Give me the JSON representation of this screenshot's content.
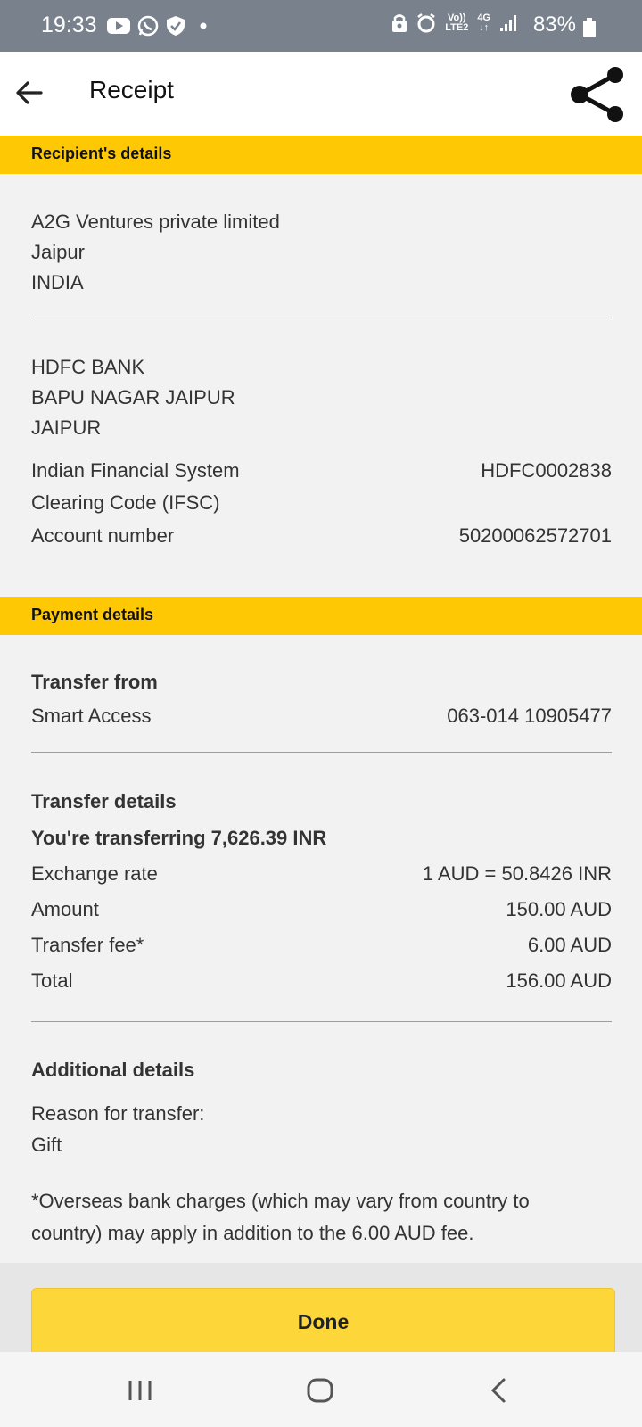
{
  "status_bar": {
    "time": "19:33",
    "battery": "83%",
    "network_top": "Vo))",
    "network_bottom": "LTE2",
    "net_type": "4G"
  },
  "header": {
    "title": "Receipt"
  },
  "recipient": {
    "section_title": "Recipient's details",
    "name": "A2G Ventures private limited",
    "city": "Jaipur",
    "country": "INDIA",
    "bank_name": "HDFC BANK",
    "branch": "BAPU NAGAR JAIPUR",
    "bank_city": "JAIPUR",
    "ifsc_label_1": "Indian Financial System",
    "ifsc_label_2": "Clearing Code (IFSC)",
    "ifsc_value": "HDFC0002838",
    "account_label": "Account number",
    "account_value": "50200062572701"
  },
  "payment": {
    "section_title": "Payment details",
    "transfer_from_heading": "Transfer from",
    "from_account_name": "Smart Access",
    "from_account_number": "063-014 10905477",
    "transfer_details_heading": "Transfer details",
    "transferring_text": "You're transferring 7,626.39 INR",
    "rows": [
      {
        "label": "Exchange rate",
        "value": "1 AUD = 50.8426 INR"
      },
      {
        "label": "Amount",
        "value": "150.00 AUD"
      },
      {
        "label": "Transfer fee*",
        "value": "6.00 AUD"
      },
      {
        "label": "Total",
        "value": "156.00 AUD"
      }
    ],
    "additional_heading": "Additional details",
    "reason_label": "Reason for transfer:",
    "reason_value": "Gift",
    "footnote_line1": "*Overseas bank charges (which may vary from country to",
    "footnote_line2": "country) may apply in addition to the 6.00 AUD fee."
  },
  "actions": {
    "done_label": "Done"
  },
  "icons": [
    "back-arrow-icon",
    "share-icon",
    "youtube-icon",
    "whatsapp-icon",
    "shield-icon",
    "alarm-icon",
    "signal-icon",
    "battery-icon"
  ],
  "colors": {
    "accent_yellow": "#ffc805",
    "button_yellow": "#fdd73a",
    "status_bar": "#79828c"
  }
}
